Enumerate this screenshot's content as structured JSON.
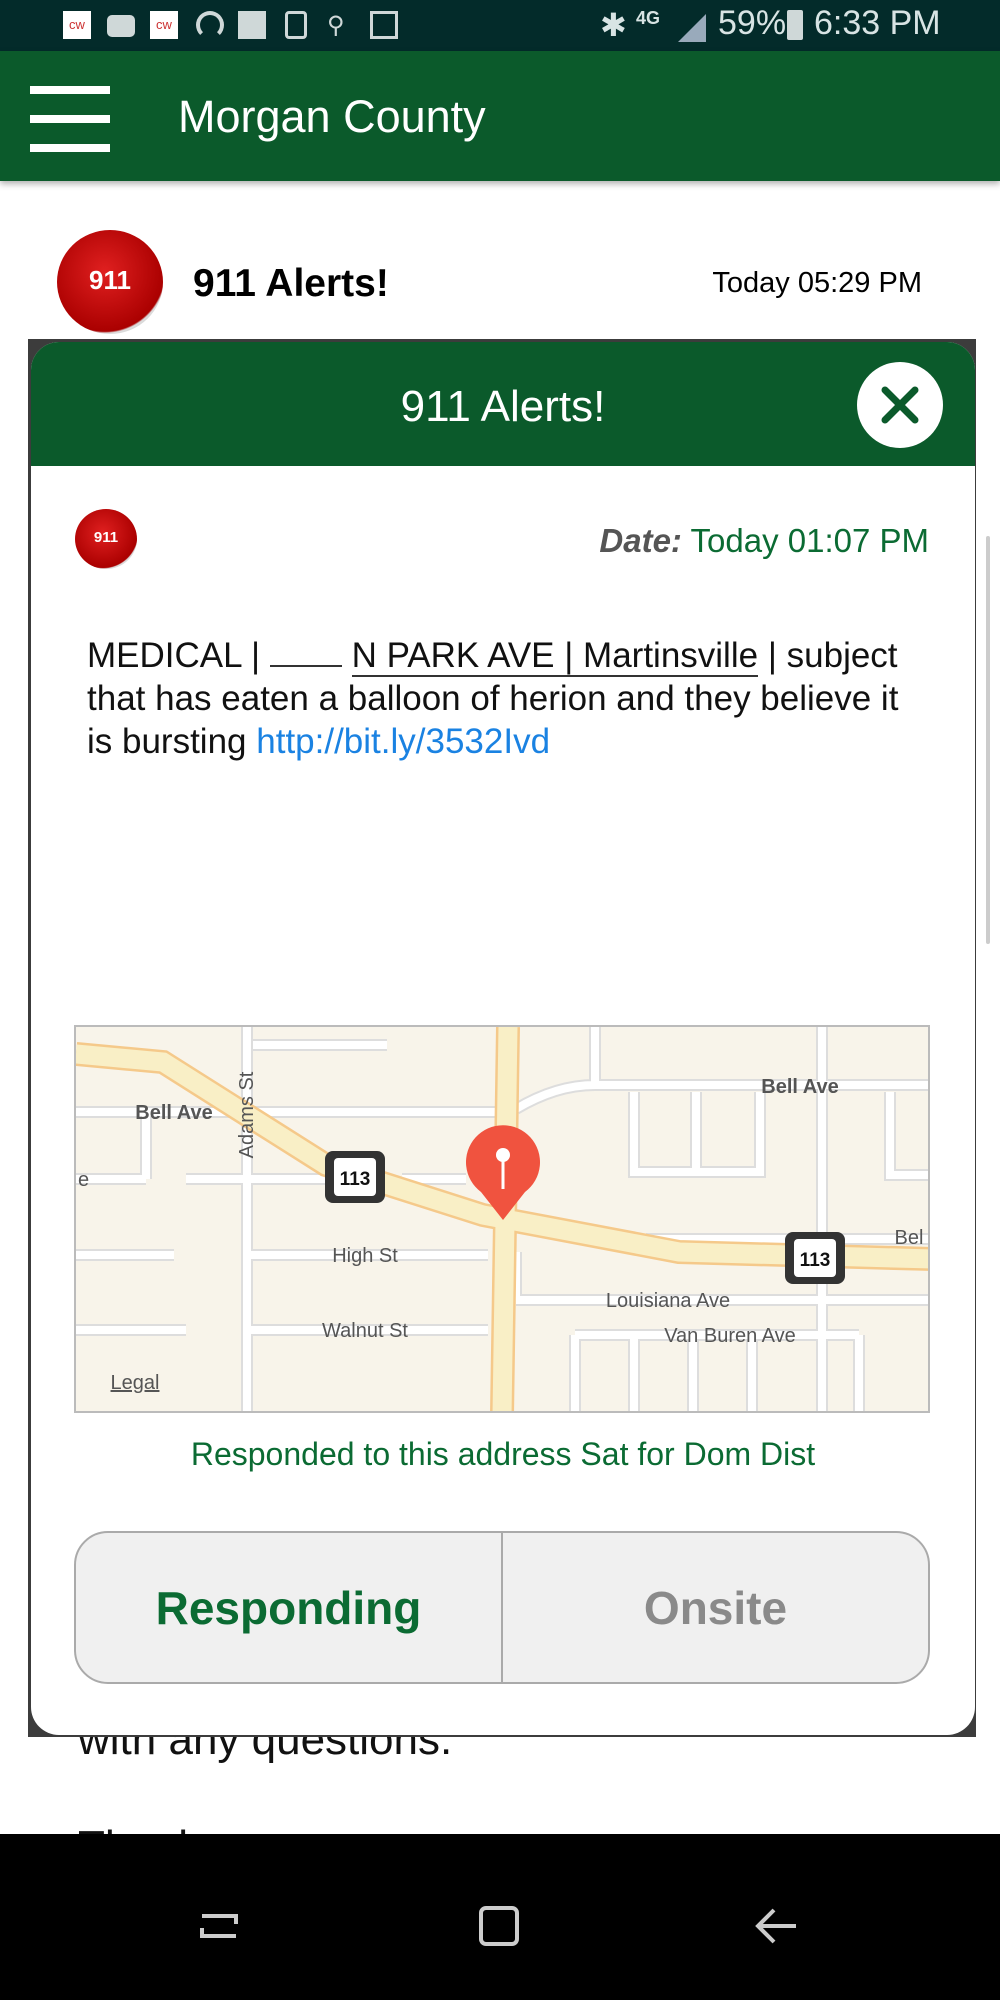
{
  "status_bar": {
    "icons": [
      "cw-app-icon",
      "youtube-icon",
      "cw-app-icon",
      "speedometer-icon",
      "email-icon",
      "screen-rotate-icon",
      "contacts-icon",
      "news-icon"
    ],
    "network": "4G",
    "battery": "59%",
    "time": "6:33 PM"
  },
  "app_bar": {
    "title": "Morgan County",
    "menu_icon": "hamburger-icon"
  },
  "list_item": {
    "title": "911 Alerts!",
    "time": "Today 05:29 PM",
    "icon_text": "911"
  },
  "background_text": {
    "line1": "with any questions.",
    "line2": "Thank you."
  },
  "modal": {
    "title": "911 Alerts!",
    "date_label": "Date:",
    "date_value": "Today 01:07 PM",
    "message": {
      "part1": "MEDICAL | ",
      "address": "N PARK AVE | Martinsville",
      "part2": " | subject that has eaten a balloon of herion and they believe it is bursting ",
      "link": "http://bit.ly/3532Ivd"
    },
    "map": {
      "labels": {
        "bell_ave_w": "Bell Ave",
        "bell_ave_e": "Bell Ave",
        "adams": "Adams St",
        "high": "High St",
        "louisiana": "Louisiana Ave",
        "walnut": "Walnut St",
        "van_buren": "Van Buren Ave",
        "bel": "Bel",
        "e": "e",
        "legal": "Legal",
        "route1": "113",
        "route2": "113"
      }
    },
    "responded_note": "Responded to this address Sat for Dom Dist",
    "buttons": {
      "responding": "Responding",
      "onsite": "Onsite"
    }
  },
  "colors": {
    "brand_green": "#0b5a2b",
    "link": "#1a82e2",
    "pin": "#f0533f"
  }
}
